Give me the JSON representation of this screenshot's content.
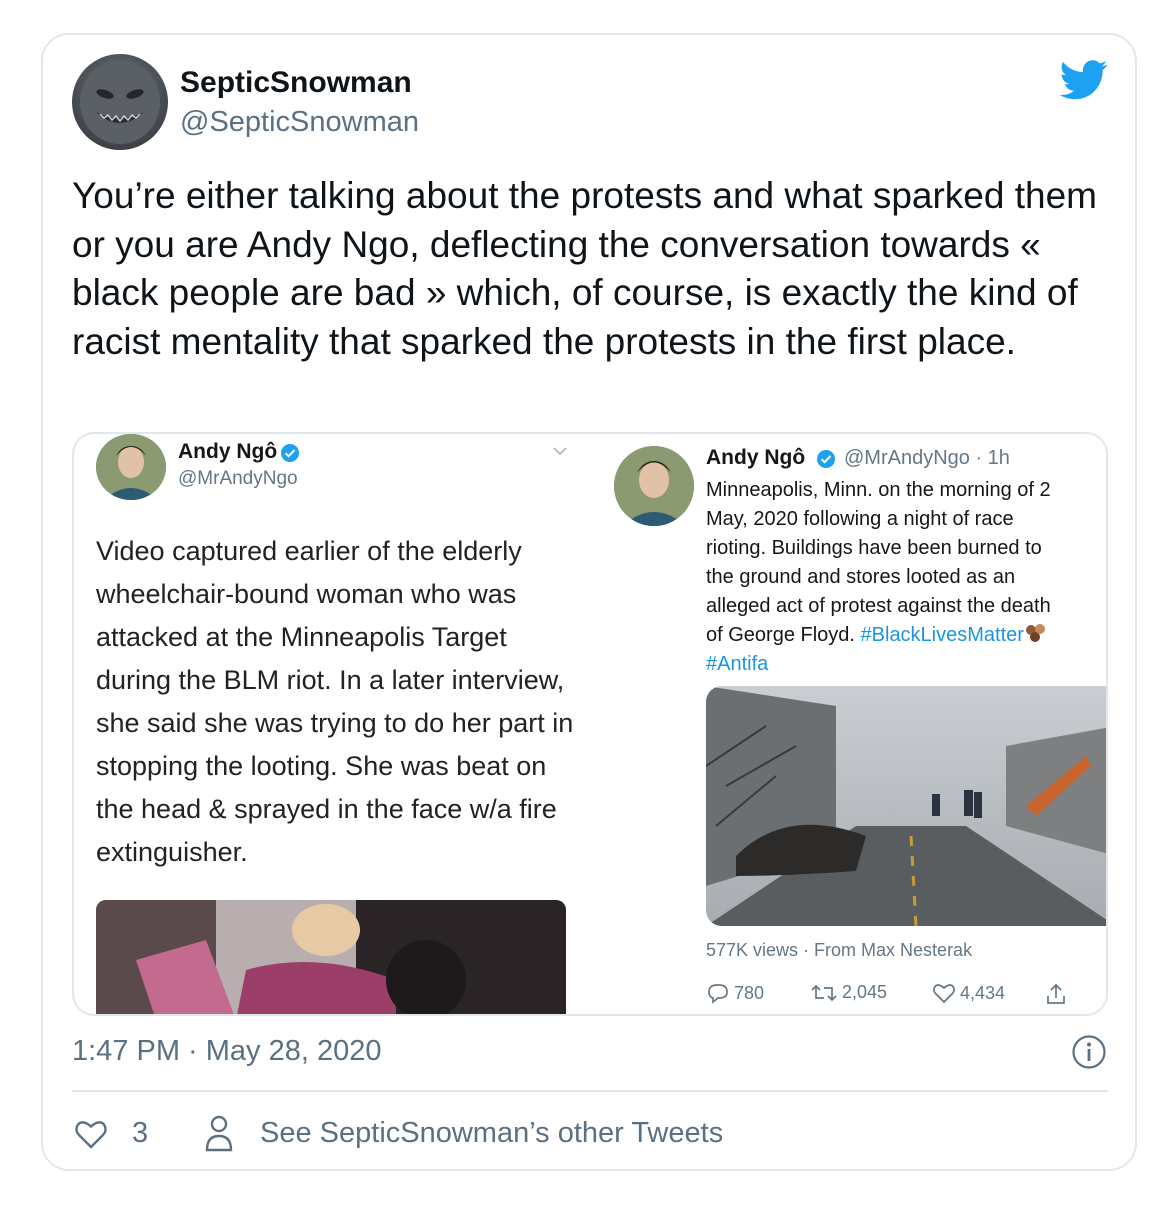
{
  "tweet": {
    "display_name": "SepticSnowman",
    "handle": "@SepticSnowman",
    "text": "You’re either talking about the protests and what sparked them or you are Andy Ngo, deflecting the conversation towards « black people are bad » which, of course, is exactly the kind of racist mentality that sparked the protests in the first place.",
    "timestamp": "1:47 PM · May 28, 2020",
    "like_count": "3",
    "other_tweets_label": "See SepticSnowman’s other Tweets"
  },
  "embedded_left": {
    "name": "Andy Ngô",
    "handle": "@MrAndyNgo",
    "text": "Video captured earlier of the elderly wheelchair-bound woman who was attacked at the Minneapolis Target during the BLM riot. In a later interview, she said she was trying to do her part in stopping the looting. She was beat on the head & sprayed in the face w/a fire extinguisher."
  },
  "embedded_right": {
    "name": "Andy Ngô",
    "handle_time": "@MrAndyNgo · 1h",
    "lines": [
      "Minneapolis, Minn. on the morning of 2",
      "May, 2020 following a night of race",
      "rioting. Buildings have been burned to",
      "the ground and stores looted as an",
      "alleged act of protest against the death"
    ],
    "line6": "of George Floyd. ",
    "hashtag1": "#BlackLivesMatter",
    "hashtag2": "#Antifa",
    "views": "577K views · From Max Nesterak",
    "replies": "780",
    "retweets": "2,045",
    "likes": "4,434"
  },
  "colors": {
    "brand": "#1da1f2",
    "text": "#0f1419",
    "secondary": "#5b7083",
    "border": "#e1e8ed",
    "hashtag": "#1b95e0"
  },
  "icons": [
    "twitter-bird-icon",
    "verified-badge-icon",
    "info-icon",
    "heart-icon",
    "person-icon",
    "reply-icon",
    "retweet-icon",
    "share-icon",
    "chevron-down-icon"
  ]
}
